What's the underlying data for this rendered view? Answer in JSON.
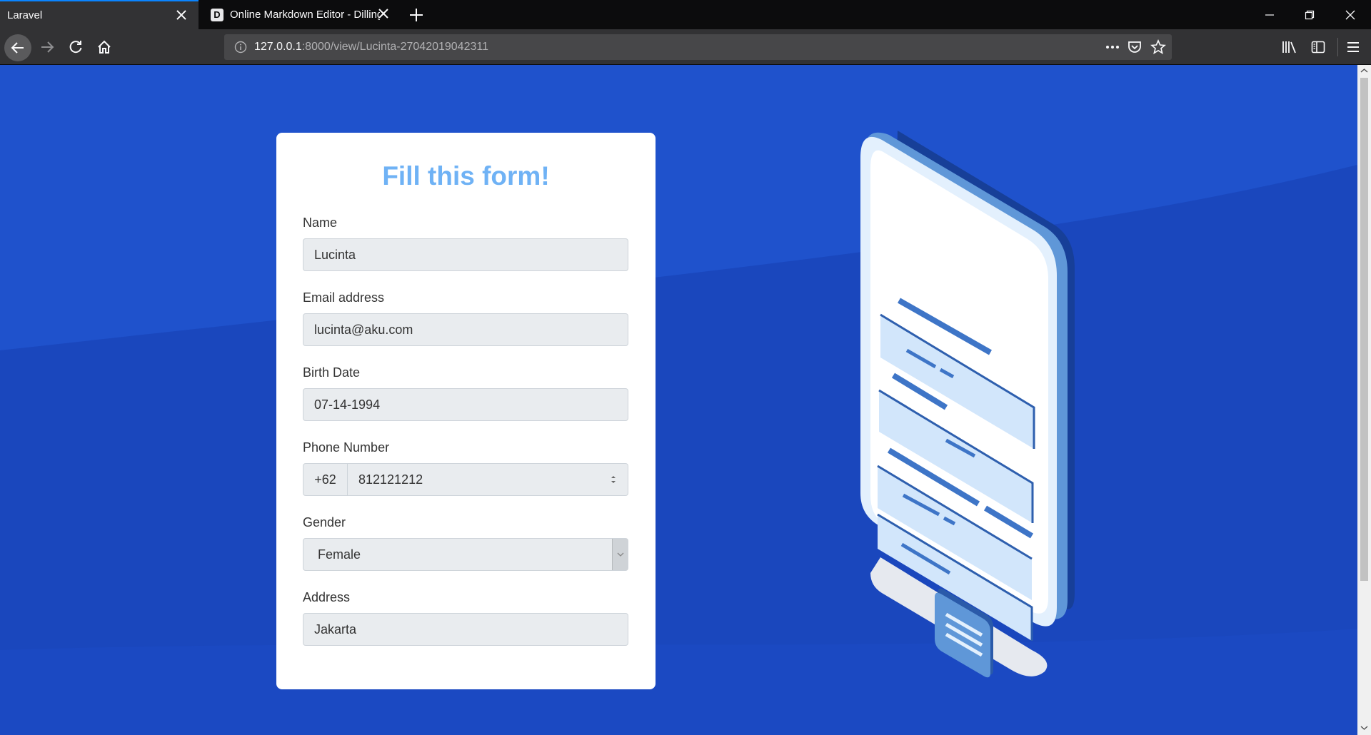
{
  "browser": {
    "tabs": [
      {
        "title": "Laravel",
        "active": true
      },
      {
        "title": "Online Markdown Editor - Dillinger",
        "favicon": "D",
        "active": false
      }
    ],
    "url_host": "127.0.0.1",
    "url_rest": ":8000/view/Lucinta-27042019042311"
  },
  "form": {
    "title": "Fill this form!",
    "name_label": "Name",
    "name_value": "Lucinta",
    "email_label": "Email address",
    "email_value": "lucinta@aku.com",
    "birth_label": "Birth Date",
    "birth_value": "07-14-1994",
    "phone_label": "Phone Number",
    "phone_prefix": "+62",
    "phone_value": "812121212",
    "gender_label": "Gender",
    "gender_value": "Female",
    "address_label": "Address",
    "address_value": "Jakarta"
  },
  "colors": {
    "page_background": "#1e50c9",
    "title_accent": "#6fb2f5",
    "tab_accent": "#0a84ff"
  }
}
